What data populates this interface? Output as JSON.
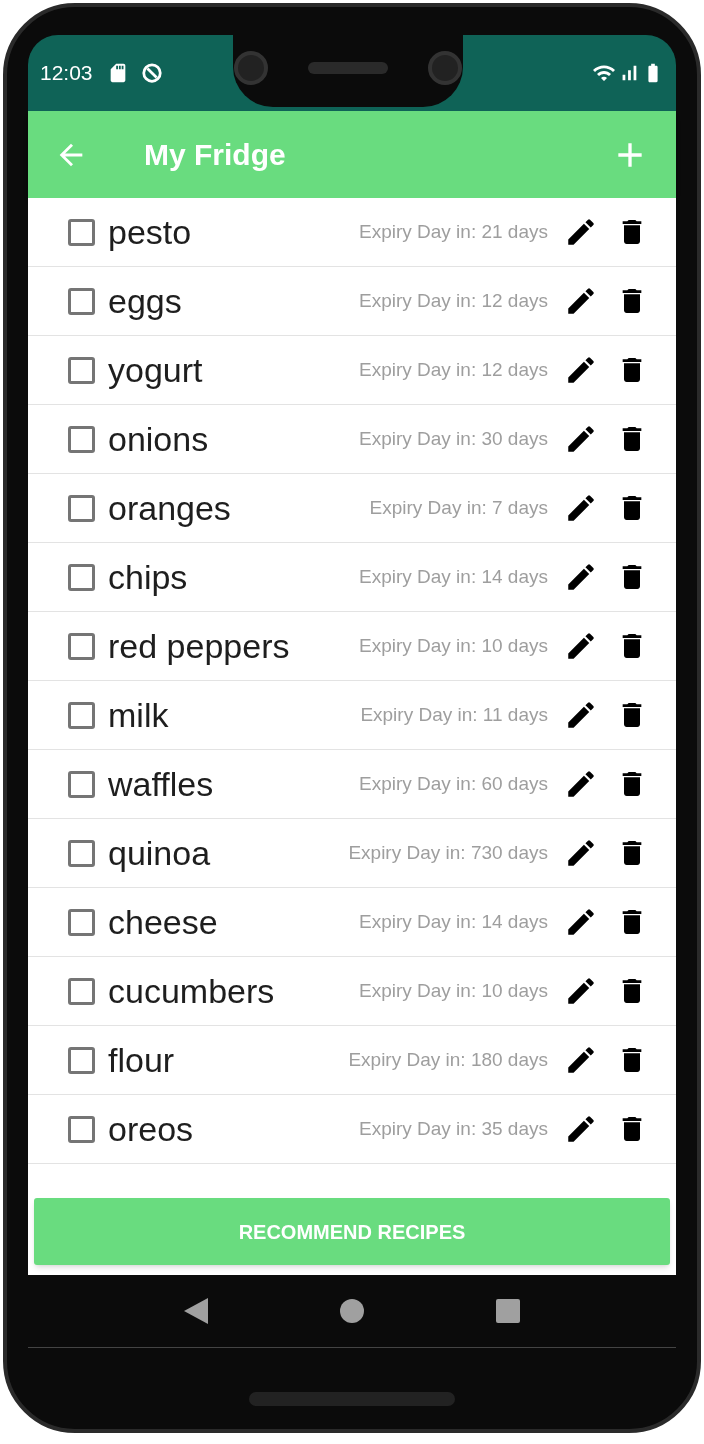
{
  "status_bar": {
    "time": "12:03"
  },
  "app_bar": {
    "title": "My Fridge"
  },
  "items": [
    {
      "name": "pesto",
      "expiry": "Expiry Day in: 21 days",
      "checked": false
    },
    {
      "name": "eggs",
      "expiry": "Expiry Day in: 12 days",
      "checked": false
    },
    {
      "name": "yogurt",
      "expiry": "Expiry Day in: 12 days",
      "checked": false
    },
    {
      "name": "onions",
      "expiry": "Expiry Day in: 30 days",
      "checked": false
    },
    {
      "name": "oranges",
      "expiry": "Expiry Day in: 7 days",
      "checked": false
    },
    {
      "name": "chips",
      "expiry": "Expiry Day in: 14 days",
      "checked": false
    },
    {
      "name": "red peppers",
      "expiry": "Expiry Day in: 10 days",
      "checked": false
    },
    {
      "name": "milk",
      "expiry": "Expiry Day in: 11 days",
      "checked": false
    },
    {
      "name": "waffles",
      "expiry": "Expiry Day in: 60 days",
      "checked": false
    },
    {
      "name": "quinoa",
      "expiry": "Expiry Day in: 730 days",
      "checked": false
    },
    {
      "name": "cheese",
      "expiry": "Expiry Day in: 14 days",
      "checked": false
    },
    {
      "name": "cucumbers",
      "expiry": "Expiry Day in: 10 days",
      "checked": false
    },
    {
      "name": "flour",
      "expiry": "Expiry Day in: 180 days",
      "checked": false
    },
    {
      "name": "oreos",
      "expiry": "Expiry Day in: 35 days",
      "checked": false
    }
  ],
  "button": "RECOMMEND RECIPES"
}
